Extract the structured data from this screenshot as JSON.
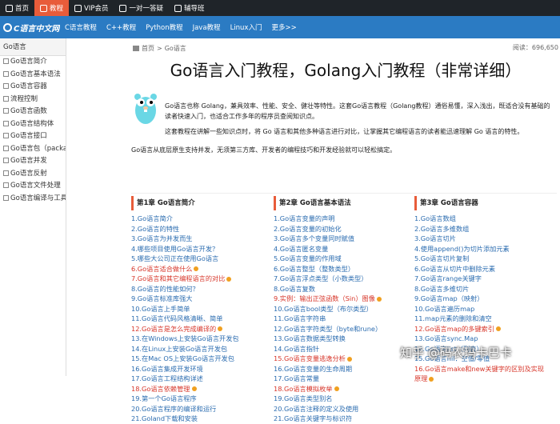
{
  "topbar": {
    "items": [
      {
        "label": "首页",
        "icon": "home-icon"
      },
      {
        "label": "教程",
        "icon": "book-icon",
        "active": true
      },
      {
        "label": "VIP会员",
        "icon": "crown-icon"
      },
      {
        "label": "一对一答疑",
        "icon": "chat-icon"
      },
      {
        "label": "辅导班",
        "icon": "notes-icon"
      }
    ]
  },
  "navbar": {
    "logo": "C语言中文网",
    "items": [
      "C语言教程",
      "C++教程",
      "Python教程",
      "Java教程",
      "Linux入门",
      "更多>>"
    ]
  },
  "sidebar": {
    "header": "Go语言",
    "items": [
      "Go语言简介",
      "Go语言基本语法",
      "Go语言容器",
      "流程控制",
      "Go语言函数",
      "Go语言结构体",
      "Go语言接口",
      "Go语言包（package）",
      "Go语言并发",
      "Go语言反射",
      "Go语言文件处理",
      "Go语言编译与工具"
    ]
  },
  "breadcrumb": {
    "home": "首页",
    "sep": ">",
    "current": "Go语言"
  },
  "reads": "阅读：696,650",
  "page_title": "Go语言入门教程，Golang入门教程（非常详细）",
  "intro": {
    "p1a": "Go语言也称 Golang，兼具效率、性能、安全、健壮等特性。这套Go语言教程（Golang教程）通俗易懂，深入浅出，既适合没有基础的",
    "p1b": "读者快速入门，也适合工作多年的程序员查阅知识点。",
    "p2": "这套教程在讲解一些知识点时，将 Go 语言和其他多种语言进行对比，让掌握其它编程语言的读者能迅速理解 Go 语言的特性。",
    "p3": "Go语言从底层原生支持并发，无须第三方库、开发者的编程技巧和开发经验就可以轻松搞定。"
  },
  "chapters": [
    {
      "title": "第1章 Go语言简介",
      "items": [
        {
          "t": "1.Go语言简介"
        },
        {
          "t": "2.Go语言的特性"
        },
        {
          "t": "3.Go语言为并发而生"
        },
        {
          "t": "4.哪些项目使用Go语言开发？"
        },
        {
          "t": "5.哪些大公司正在使用Go语言"
        },
        {
          "t": "6.Go语言适合做什么",
          "red": true,
          "vip": true
        },
        {
          "t": "7.Go语言和其它编程语言的对比",
          "red": true,
          "vip": true
        },
        {
          "t": "8.Go语言的性能如何？"
        },
        {
          "t": "9.Go语言标准库强大"
        },
        {
          "t": "10.Go语言上手简单"
        },
        {
          "t": "11.Go语言代码风格清晰、简单"
        },
        {
          "t": "12.Go语言是怎么完成编译的",
          "red": true,
          "vip": true
        },
        {
          "t": "13.在Windows上安装Go语言开发包"
        },
        {
          "t": "14.在Linux上安装Go语言开发包"
        },
        {
          "t": "15.在Mac OS上安装Go语言开发包"
        },
        {
          "t": "16.Go语言集成开发环境"
        },
        {
          "t": "17.Go语言工程结构详述"
        },
        {
          "t": "18.Go语言依赖管理",
          "red": true,
          "vip": true
        },
        {
          "t": "19.第一个Go语言程序"
        },
        {
          "t": "20.Go语言程序的编译和运行"
        },
        {
          "t": "21.Goland下载和安装"
        }
      ]
    },
    {
      "title": "第2章 Go语言基本语法",
      "items": [
        {
          "t": "1.Go语言变量的声明"
        },
        {
          "t": "2.Go语言变量的初始化"
        },
        {
          "t": "3.Go语言多个变量同时赋值"
        },
        {
          "t": "4.Go语言匿名变量"
        },
        {
          "t": "5.Go语言变量的作用域"
        },
        {
          "t": "6.Go语言整型（整数类型）"
        },
        {
          "t": "7.Go语言浮点类型（小数类型）"
        },
        {
          "t": "8.Go语言复数"
        },
        {
          "t": "9.实例：输出正弦函数（Sin）图像",
          "red": true,
          "vip": true
        },
        {
          "t": "10.Go语言bool类型（布尔类型）"
        },
        {
          "t": "11.Go语言字符串"
        },
        {
          "t": "12.Go语言字符类型（byte和rune）"
        },
        {
          "t": "13.Go语言数据类型转换"
        },
        {
          "t": "14.Go语言指针"
        },
        {
          "t": "15.Go语言变量逃逸分析",
          "red": true,
          "vip": true
        },
        {
          "t": "16.Go语言变量的生命周期"
        },
        {
          "t": "17.Go语言常量"
        },
        {
          "t": "18.Go语言模拟枚举",
          "red": true,
          "vip": true
        },
        {
          "t": "19.Go语言类型别名"
        },
        {
          "t": "20.Go语言注释的定义及使用"
        },
        {
          "t": "21.Go语言关键字与标识符"
        }
      ]
    },
    {
      "title": "第3章 Go语言容器",
      "items": [
        {
          "t": "1.Go语言数组"
        },
        {
          "t": "2.Go语言多维数组"
        },
        {
          "t": "3.Go语言切片"
        },
        {
          "t": "4.使用append()为切片添加元素"
        },
        {
          "t": "5.Go语言切片复制"
        },
        {
          "t": "6.Go语言从切片中删除元素"
        },
        {
          "t": "7.Go语言range关键字"
        },
        {
          "t": "8.Go语言多维切片"
        },
        {
          "t": "9.Go语言map（映射）"
        },
        {
          "t": "10.Go语言遍历map"
        },
        {
          "t": "11.map元素的删除和清空"
        },
        {
          "t": "12.Go语言map的多键索引",
          "red": true,
          "vip": true
        },
        {
          "t": "13.Go语言sync.Map"
        },
        {
          "t": "14.Go语言list（列表）"
        },
        {
          "t": "15.Go语言nil：空值/零值"
        },
        {
          "t": "16.Go语言make和new关键字的区别及实现",
          "red": true
        },
        {
          "t": "原理",
          "red": true,
          "vip": true
        }
      ]
    }
  ],
  "watermark": "知乎 @码农玛卡巴卡",
  "colors": {
    "topbar": "#1f2429",
    "active_tab": "#e85c3a",
    "navbar": "#2b7bc3",
    "link": "#2b6cb0",
    "link_red": "#d7362a"
  }
}
